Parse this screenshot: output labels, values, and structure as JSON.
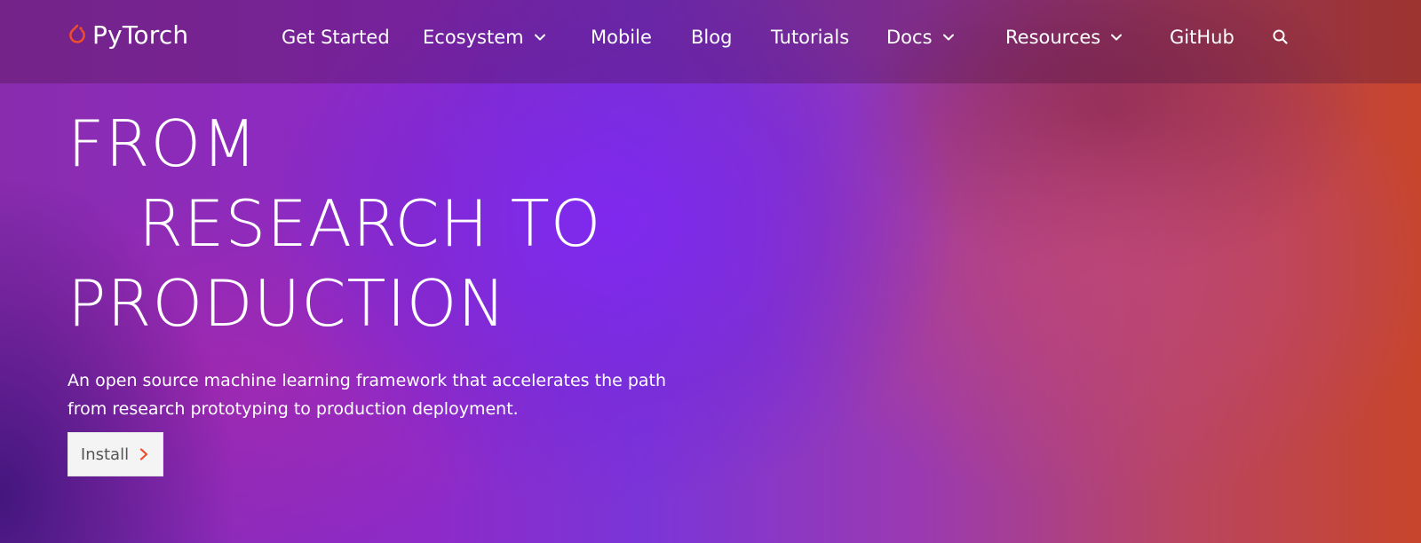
{
  "brand": {
    "name": "PyTorch",
    "accent_color": "#ee4c2c"
  },
  "nav": {
    "items": [
      {
        "label": "Get Started",
        "dropdown": false
      },
      {
        "label": "Ecosystem",
        "dropdown": true
      },
      {
        "label": "Mobile",
        "dropdown": false
      },
      {
        "label": "Blog",
        "dropdown": false
      },
      {
        "label": "Tutorials",
        "dropdown": false
      },
      {
        "label": "Docs",
        "dropdown": true
      },
      {
        "label": "Resources",
        "dropdown": true
      },
      {
        "label": "GitHub",
        "dropdown": false
      }
    ],
    "search_icon": "search-icon"
  },
  "hero": {
    "headline": [
      "FROM",
      "RESEARCH TO",
      "PRODUCTION"
    ],
    "subtitle": "An open source machine learning framework that accelerates the path from research prototyping to production deployment.",
    "cta_label": "Install"
  }
}
